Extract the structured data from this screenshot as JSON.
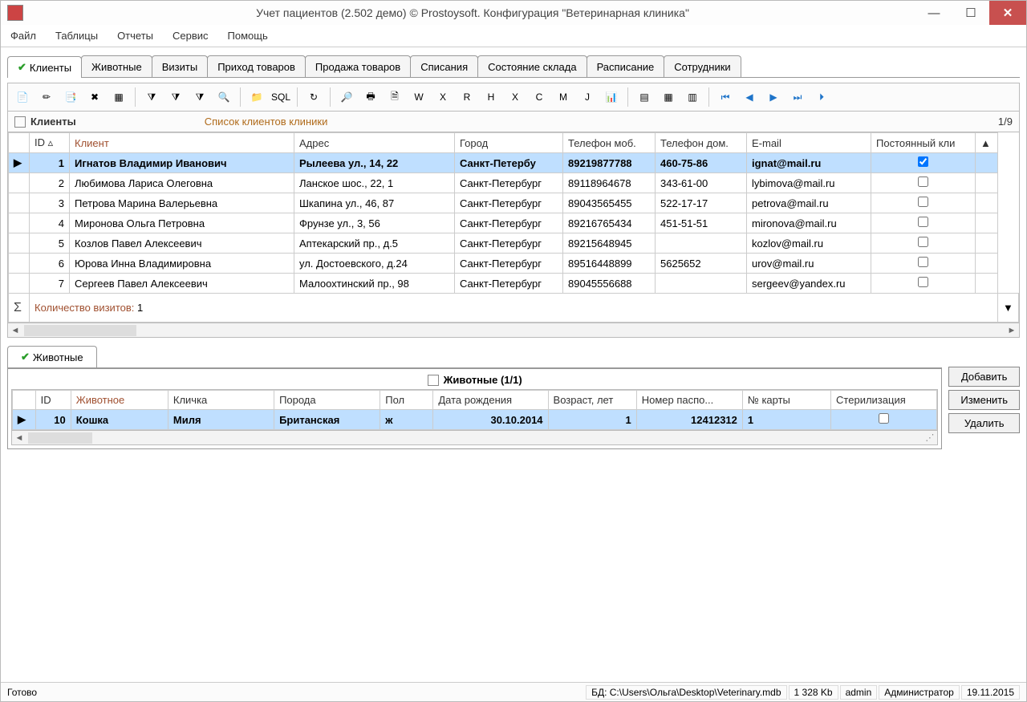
{
  "window": {
    "title": "Учет пациентов (2.502 демо) © Prostoysoft. Конфигурация \"Ветеринарная клиника\""
  },
  "menubar": [
    "Файл",
    "Таблицы",
    "Отчеты",
    "Сервис",
    "Помощь"
  ],
  "tabs": [
    "Клиенты",
    "Животные",
    "Визиты",
    "Приход товаров",
    "Продажа товаров",
    "Списания",
    "Состояние склада",
    "Расписание",
    "Сотрудники"
  ],
  "active_tab_index": 0,
  "section": {
    "title": "Клиенты",
    "subtitle": "Список клиентов клиники",
    "count": "1/9"
  },
  "clients": {
    "columns": [
      "ID",
      "Клиент",
      "Адрес",
      "Город",
      "Телефон моб.",
      "Телефон дом.",
      "E-mail",
      "Постоянный кли"
    ],
    "key_column_index": 1,
    "rows": [
      {
        "id": "1",
        "client": "Игнатов Владимир Иванович",
        "addr": "Рылеева ул., 14, 22",
        "city": "Санкт-Петербу",
        "mob": "89219877788",
        "home": "460-75-86",
        "email": "ignat@mail.ru",
        "perm": true,
        "selected": true
      },
      {
        "id": "2",
        "client": "Любимова Лариса Олеговна",
        "addr": "Ланское шос., 22, 1",
        "city": "Санкт-Петербург",
        "mob": "89118964678",
        "home": "343-61-00",
        "email": "lybimova@mail.ru",
        "perm": false
      },
      {
        "id": "3",
        "client": "Петрова Марина Валерьевна",
        "addr": "Шкапина ул., 46, 87",
        "city": "Санкт-Петербург",
        "mob": "89043565455",
        "home": "522-17-17",
        "email": "petrova@mail.ru",
        "perm": false
      },
      {
        "id": "4",
        "client": "Миронова Ольга Петровна",
        "addr": "Фрунзе ул., 3, 56",
        "city": "Санкт-Петербург",
        "mob": "89216765434",
        "home": "451-51-51",
        "email": "mironova@mail.ru",
        "perm": false
      },
      {
        "id": "5",
        "client": "Козлов Павел Алексеевич",
        "addr": "Аптекарский пр., д.5",
        "city": "Санкт-Петербург",
        "mob": "89215648945",
        "home": "",
        "email": "kozlov@mail.ru",
        "perm": false
      },
      {
        "id": "6",
        "client": "Юрова Инна Владимировна",
        "addr": "ул. Достоевского, д.24",
        "city": "Санкт-Петербург",
        "mob": "89516448899",
        "home": "5625652",
        "email": "urov@mail.ru",
        "perm": false
      },
      {
        "id": "7",
        "client": "Сергеев Павел Алексеевич",
        "addr": "Малоохтинский пр., 98",
        "city": "Санкт-Петербург",
        "mob": "89045556688",
        "home": "",
        "email": "sergeev@yandex.ru",
        "perm": false
      }
    ],
    "summary_label": "Количество визитов:",
    "summary_value": "1"
  },
  "lower_tab": "Животные",
  "animals": {
    "title": "Животные (1/1)",
    "columns": [
      "ID",
      "Животное",
      "Кличка",
      "Порода",
      "Пол",
      "Дата рождения",
      "Возраст, лет",
      "Номер паспо...",
      "№ карты",
      "Стерилизация"
    ],
    "key_column_index": 1,
    "rows": [
      {
        "id": "10",
        "animal": "Кошка",
        "nick": "Миля",
        "breed": "Британская",
        "sex": "ж",
        "dob": "30.10.2014",
        "age": "1",
        "passport": "12412312",
        "card": "1",
        "ster": false,
        "selected": true
      }
    ]
  },
  "buttons": {
    "add": "Добавить",
    "edit": "Изменить",
    "delete": "Удалить"
  },
  "status": {
    "ready": "Готово",
    "db_label": "БД:",
    "db_path": "C:\\Users\\Ольга\\Desktop\\Veterinary.mdb",
    "db_size": "1 328 Kb",
    "user": "admin",
    "role": "Администратор",
    "date": "19.11.2015"
  },
  "toolbar_icons": [
    "add-record",
    "edit-record",
    "copy",
    "delete",
    "table",
    "filter",
    "filter-clear",
    "filter-add",
    "search",
    "folder",
    "sql",
    "refresh",
    "find",
    "print",
    "preview",
    "export-doc",
    "export-xls",
    "export-rtf",
    "export-html",
    "export-xlsx",
    "export-csv",
    "export-xml",
    "export-json",
    "chart",
    "report",
    "grid",
    "columns",
    "nav-first",
    "nav-prev",
    "nav-next",
    "nav-last",
    "nav-end"
  ]
}
